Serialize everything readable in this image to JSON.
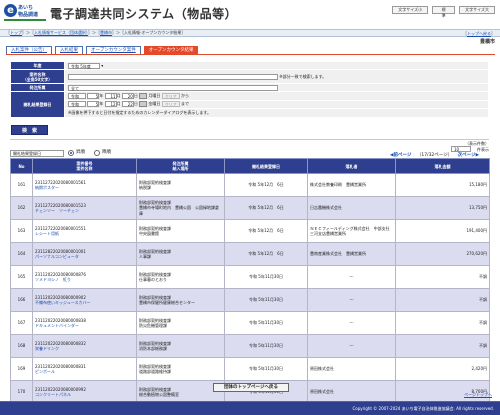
{
  "header": {
    "logo_line1": "あいち",
    "logo_line2": "物品調達",
    "title": "電子調達共同システム（物品等）",
    "font_small": "文字サイズ小",
    "font_std": "標　準",
    "font_large": "文字サイズ大"
  },
  "breadcrumb": {
    "top": "トップ",
    "service": "入札情報サービス（団体選択）",
    "city": "豊橋市",
    "current": "入札情報-オープンカウンタ結果",
    "right_link": "トップへ戻る"
  },
  "department": "豊橋市",
  "tabs": [
    "入札案件（公告）",
    "入札結果",
    "オープンカウンタ案件",
    "オープンカウンタ結果"
  ],
  "form": {
    "year_label": "年度",
    "year_value": "令和 5年度",
    "name_label": "案件名称\n（全角50文字）",
    "name_hint": "※部分一致で検索します。",
    "dept_label": "発注所属",
    "dept_value": "全て",
    "date_label": "開札結果登録日",
    "from_era": "令和",
    "from_y": "5",
    "from_m": "11",
    "from_d": "20",
    "from_dow": "月",
    "to_era": "令和",
    "to_y": "5",
    "to_m": "12",
    "to_d": "22",
    "to_dow": "金",
    "clear": "クリア",
    "kara": "から",
    "made": "まで",
    "unit_y": "年",
    "unit_m": "月",
    "unit_d": "日",
    "unit_dow": "曜日",
    "cal_hint": "※画像を押下すると日付を指定するためのカレンダーダイアログを表示します。",
    "search_button": "検　索"
  },
  "sort": {
    "select_value": "開札結果登録日",
    "asc": "昇順",
    "desc": "降順",
    "total": "（表示件数）",
    "per_page": "10",
    "per_label": "件表示",
    "prev": "前ページ",
    "page_info": "（17/32ページ）",
    "next": "次ページ"
  },
  "table": {
    "headers": [
      "No",
      "案件番号\n案件名称",
      "発注所属\n納入場所",
      "開札結果登録日",
      "落札者",
      "落札金額"
    ],
    "rows": [
      {
        "no": "161",
        "num": "23112722020080001561",
        "name": "納期ポスター",
        "dept": "財務部契約検査課",
        "place": "納税課",
        "date": "令和 5年12月　6日",
        "winner": "株式会社教養印刷　豊橋営業所",
        "amount": "15,180円"
      },
      {
        "no": "162",
        "num": "23112722020080001523",
        "name": "チェンソー　ソーチェン",
        "dept": "財務部契約検査課",
        "place": "豊橋市寺場町地内　豊橋公園　公園緑地課倉庫",
        "date": "令和 5年12月　6日",
        "winner": "日吉農機株式会社",
        "amount": "13,750円"
      },
      {
        "no": "163",
        "num": "23112722020080001551",
        "name": "レシート用紙",
        "dept": "財務部契約検査課",
        "place": "中央図書館",
        "date": "令和 5年12月　6日",
        "winner": "ＮＥＣフィールディング株式会社　中部支社三河支店豊橋営業所",
        "amount": "191,400円"
      },
      {
        "no": "164",
        "num": "23112822020080001001",
        "name": "パーソナルコンピュータ",
        "dept": "財務部契約検査課",
        "place": "人事課",
        "date": "令和 5年12月　6日",
        "winner": "豊南産業株式会社　豊橋営業所",
        "amount": "270,620円"
      },
      {
        "no": "165",
        "num": "23112022020080000876",
        "name": "ソメドヨシノ　紅り",
        "dept": "財務部契約検査課",
        "place": "仕事暮のとおり",
        "date": "令和 5年11月30日",
        "winner": "---",
        "amount": "不調"
      },
      {
        "no": "166",
        "num": "23112022020080000902",
        "name": "不織布使いキッジュースカバー",
        "dept": "財務部契約検査課",
        "place": "豊橋市保健所健康総合センター",
        "date": "令和 5年11月30日",
        "winner": "---",
        "amount": "不調"
      },
      {
        "no": "167",
        "num": "23112022020080000838",
        "name": "ドキュメントバインダー",
        "dept": "財務部契約検査課",
        "place": "防災危機管理課",
        "date": "令和 5年11月30日",
        "winner": "---",
        "amount": "不調"
      },
      {
        "no": "168",
        "num": "23112022020080000832",
        "name": "栄養ドリンク",
        "dept": "財務部契約検査課",
        "place": "消防本部総務課",
        "date": "令和 5年11月30日",
        "winner": "---",
        "amount": "不調"
      },
      {
        "no": "169",
        "num": "23112022020080000831",
        "name": "ピンポール",
        "dept": "財務部契約検査課",
        "place": "道路部道路維持課",
        "date": "令和 5年11月30日",
        "winner": "原田株式会社",
        "amount": "2,420円"
      },
      {
        "no": "170",
        "num": "23112022020080000992",
        "name": "コンクリートパネル",
        "dept": "財務部契約検査課",
        "place": "総合動植物公園整備室",
        "date": "令和 5年11月30日",
        "winner": "原田株式会社",
        "amount": "8,700円"
      }
    ]
  },
  "back_button": "団体のトップページへ戻る",
  "to_top": "ページトップへ",
  "footer": "Copyright © 2007-2024 あいち電子自治体推進協議会. All rights reserved."
}
